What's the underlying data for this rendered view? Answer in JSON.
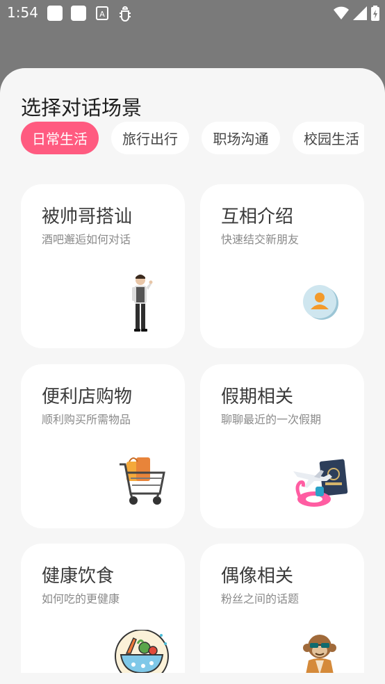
{
  "status_bar": {
    "time": "1:54"
  },
  "sheet": {
    "title": "选择对话场景",
    "tabs": [
      {
        "label": "日常生活",
        "active": true
      },
      {
        "label": "旅行出行",
        "active": false
      },
      {
        "label": "职场沟通",
        "active": false
      },
      {
        "label": "校园生活",
        "active": false
      }
    ],
    "cards": [
      {
        "title": "被帅哥搭讪",
        "subtitle": "酒吧邂逅如何对话",
        "icon": "man-standing-icon"
      },
      {
        "title": "互相介绍",
        "subtitle": "快速结交新朋友",
        "icon": "person-avatar-icon"
      },
      {
        "title": "便利店购物",
        "subtitle": "顺利购买所需物品",
        "icon": "shopping-cart-icon"
      },
      {
        "title": "假期相关",
        "subtitle": "聊聊最近的一次假期",
        "icon": "airplane-passport-icon"
      },
      {
        "title": "健康饮食",
        "subtitle": "如何吃的更健康",
        "icon": "healthy-food-bowl-icon"
      },
      {
        "title": "偶像相关",
        "subtitle": "粉丝之间的话题",
        "icon": "monkey-idol-icon"
      }
    ]
  },
  "colors": {
    "accent": "#ff5b80",
    "sheet_bg": "#f6f6f6",
    "scrim": "#7a7a7a"
  }
}
